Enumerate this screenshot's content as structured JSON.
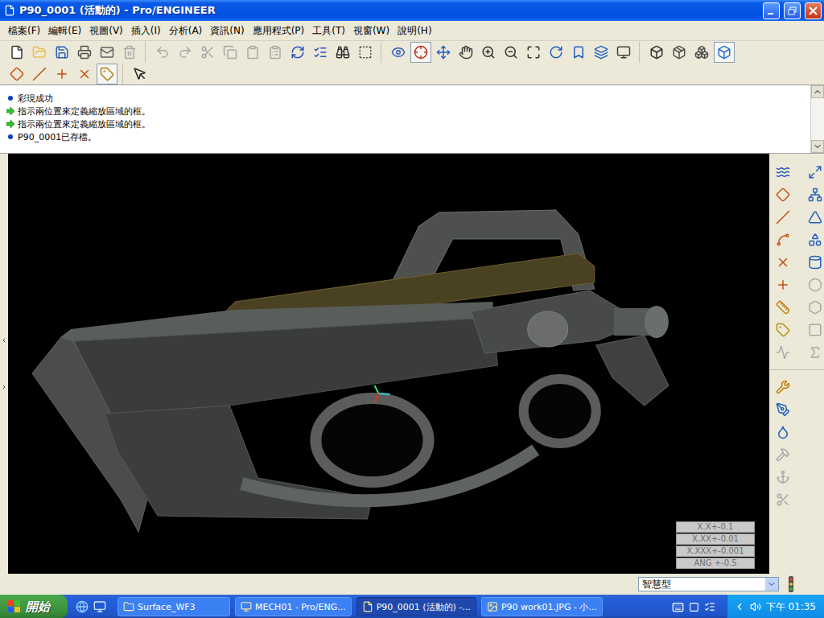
{
  "window": {
    "title": "P90_0001 (活動的) - Pro/ENGINEER"
  },
  "menu": [
    "檔案(F)",
    "編輯(E)",
    "視圖(V)",
    "插入(I)",
    "分析(A)",
    "資訊(N)",
    "應用程式(P)",
    "工具(T)",
    "視窗(W)",
    "說明(H)"
  ],
  "toolbar_top": [
    [
      {
        "pressed": false,
        "disabled": false
      },
      {
        "pressed": false,
        "disabled": false
      },
      {
        "pressed": false,
        "disabled": false
      },
      {
        "pressed": false,
        "disabled": false
      },
      {
        "pressed": false,
        "disabled": false
      },
      {
        "pressed": false,
        "disabled": true
      }
    ],
    [
      {
        "pressed": false,
        "disabled": true
      },
      {
        "pressed": false,
        "disabled": true
      },
      {
        "pressed": false,
        "disabled": true
      },
      {
        "pressed": false,
        "disabled": true
      },
      {
        "pressed": false,
        "disabled": true
      },
      {
        "pressed": false,
        "disabled": true
      },
      {
        "pressed": false,
        "disabled": false
      },
      {
        "pressed": false,
        "disabled": false
      },
      {
        "pressed": false,
        "disabled": false
      },
      {
        "pressed": false,
        "disabled": false
      }
    ],
    [
      {
        "pressed": false,
        "disabled": false
      },
      {
        "pressed": true,
        "disabled": false
      },
      {
        "pressed": false,
        "disabled": false
      },
      {
        "pressed": false,
        "disabled": false
      },
      {
        "pressed": false,
        "disabled": false
      },
      {
        "pressed": false,
        "disabled": false
      },
      {
        "pressed": false,
        "disabled": false
      },
      {
        "pressed": false,
        "disabled": false
      },
      {
        "pressed": false,
        "disabled": false
      },
      {
        "pressed": false,
        "disabled": false
      },
      {
        "pressed": false,
        "disabled": false
      }
    ],
    [
      {
        "pressed": false,
        "disabled": false
      },
      {
        "pressed": false,
        "disabled": false
      },
      {
        "pressed": false,
        "disabled": false
      },
      {
        "pressed": true,
        "disabled": false
      }
    ]
  ],
  "toolbar_second": [
    [
      {
        "pressed": false,
        "disabled": false
      },
      {
        "pressed": false,
        "disabled": false
      },
      {
        "pressed": false,
        "disabled": false
      },
      {
        "pressed": false,
        "disabled": false
      },
      {
        "pressed": true,
        "disabled": false
      }
    ],
    [
      {
        "pressed": false,
        "disabled": false
      }
    ]
  ],
  "messages": [
    {
      "kind": "info",
      "text": "彩現成功"
    },
    {
      "kind": "prompt",
      "text": "指示兩位置來定義縮放區域的框。"
    },
    {
      "kind": "prompt",
      "text": "指示兩位置來定義縮放區域的框。"
    },
    {
      "kind": "info",
      "text": "P90_0001已存檔。"
    }
  ],
  "right_toolbar": [
    [
      {
        "disabled": false
      },
      {
        "disabled": false
      },
      {
        "disabled": false
      },
      {
        "disabled": false
      },
      {
        "disabled": false
      },
      {
        "disabled": false
      },
      {
        "disabled": false
      },
      {
        "disabled": false
      },
      {
        "disabled": false
      },
      {
        "disabled": false
      },
      {
        "disabled": false
      },
      {
        "disabled": true
      },
      {
        "disabled": false
      },
      {
        "disabled": true
      },
      {
        "disabled": false
      },
      {
        "disabled": true
      },
      {
        "disabled": true
      },
      {
        "disabled": true
      }
    ],
    [
      {
        "disabled": false
      },
      {
        "disabled": false
      },
      {
        "disabled": false
      },
      {
        "disabled": true
      },
      {
        "disabled": true
      },
      {
        "disabled": true
      }
    ]
  ],
  "tolerances": [
    "X.X+-0.1",
    "X.XX+-0.01",
    "X.XXX+-0.001",
    "ANG +-0.5"
  ],
  "status_bar": {
    "filter": "智慧型"
  },
  "taskbar": {
    "start": "開始",
    "tasks": [
      {
        "label": "Surface_WF3",
        "selected": false
      },
      {
        "label": "MECH01 - Pro/ENG...",
        "selected": false
      },
      {
        "label": "P90_0001 (活動的) -...",
        "selected": true
      },
      {
        "label": "P90 work01.JPG - 小...",
        "selected": false
      }
    ],
    "clock": "下午 01:35"
  }
}
